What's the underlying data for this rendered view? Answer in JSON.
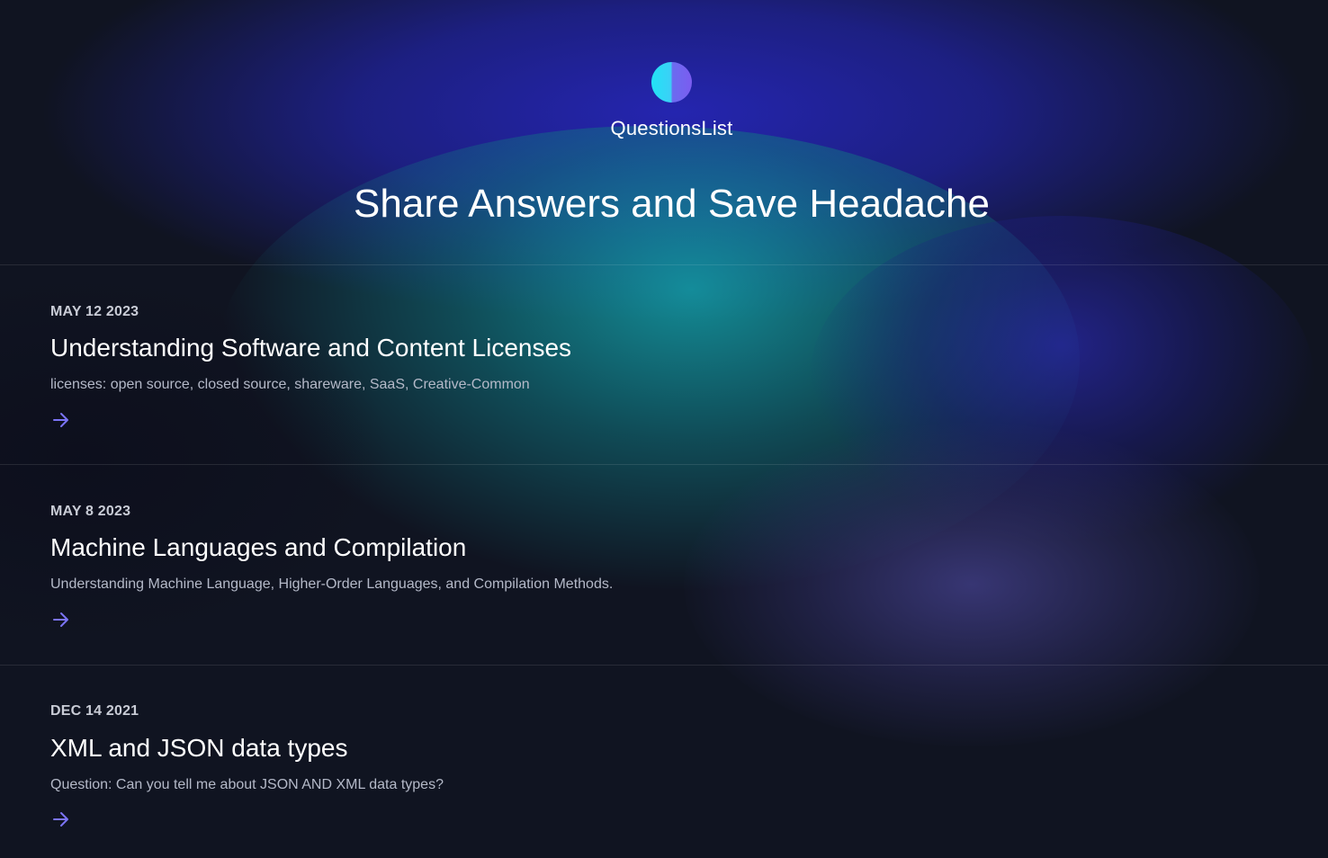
{
  "brand": {
    "name": "QuestionsList"
  },
  "hero": {
    "headline": "Share Answers and Save Headache"
  },
  "posts": [
    {
      "date": "MAY 12 2023",
      "title": "Understanding Software and Content Licenses",
      "description": "licenses: open source, closed source, shareware, SaaS, Creative-Common",
      "arrow_icon": "arrow-right-icon"
    },
    {
      "date": "MAY 8 2023",
      "title": "Machine Languages and Compilation",
      "description": "Understanding Machine Language, Higher-Order Languages, and Compilation Methods.",
      "arrow_icon": "arrow-right-icon"
    },
    {
      "date": "DEC 14 2021",
      "title": "XML and JSON data types",
      "description": "Question: Can you tell me about JSON AND XML data types?",
      "arrow_icon": "arrow-right-icon"
    }
  ],
  "colors": {
    "background": "#101421",
    "accent_arrow": "#7b74f5",
    "logo_left": "#22e3f5",
    "logo_right": "#7b5cf0"
  }
}
